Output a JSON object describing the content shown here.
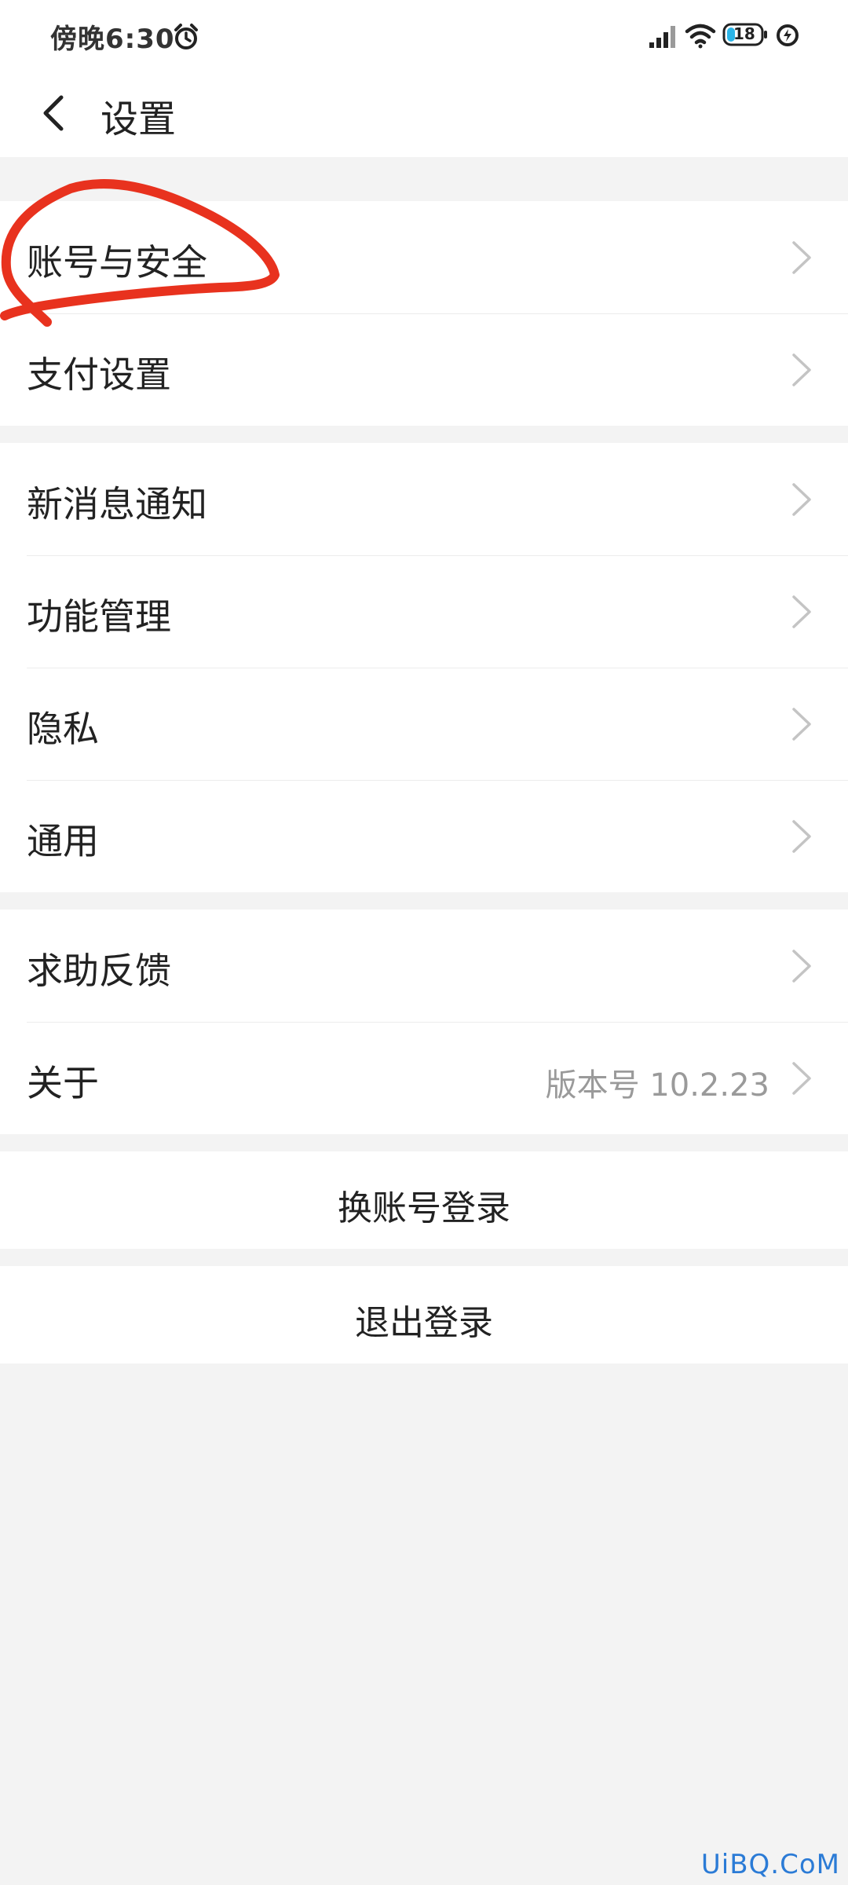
{
  "status_bar": {
    "time": "傍晚6:30",
    "battery": "18",
    "icons": [
      "alarm-icon",
      "signal-icon",
      "wifi-icon",
      "battery-icon",
      "charging-icon"
    ]
  },
  "header": {
    "title": "设置",
    "back_icon": "back-arrow-icon"
  },
  "groups": [
    {
      "items": [
        {
          "label": "账号与安全"
        },
        {
          "label": "支付设置"
        }
      ]
    },
    {
      "items": [
        {
          "label": "新消息通知"
        },
        {
          "label": "功能管理"
        },
        {
          "label": "隐私"
        },
        {
          "label": "通用"
        }
      ]
    },
    {
      "items": [
        {
          "label": "求助反馈"
        },
        {
          "label": "关于",
          "value": "版本号 10.2.23"
        }
      ]
    }
  ],
  "actions": {
    "switch_account": "换账号登录",
    "logout": "退出登录"
  },
  "annotation_color": "#e8321e",
  "watermark": "UiBQ.CoM"
}
